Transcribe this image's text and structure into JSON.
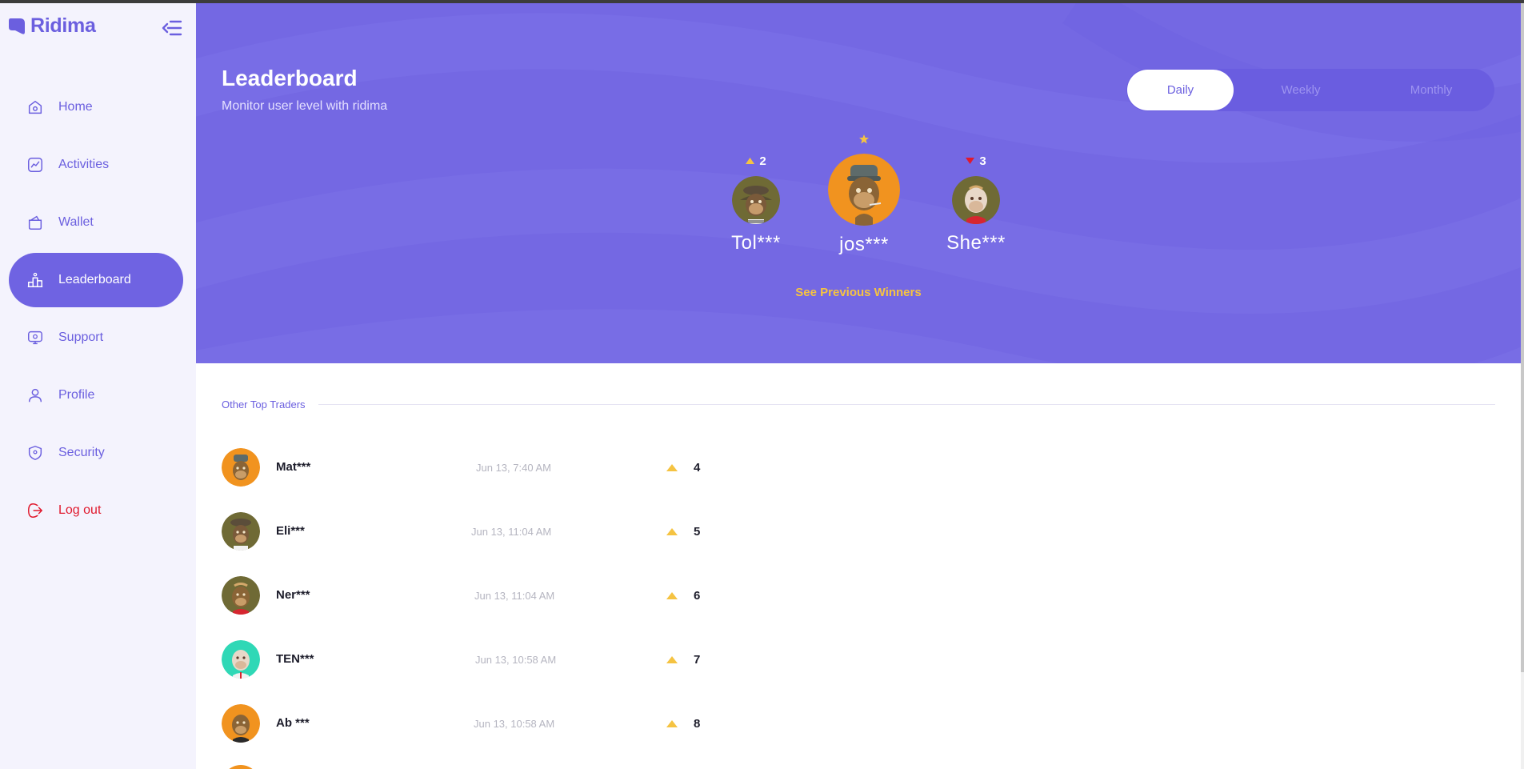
{
  "app": {
    "name": "Ridima"
  },
  "sidebar": {
    "items": [
      {
        "label": "Home",
        "icon": "home-icon"
      },
      {
        "label": "Activities",
        "icon": "chart-icon"
      },
      {
        "label": "Wallet",
        "icon": "wallet-icon"
      },
      {
        "label": "Leaderboard",
        "icon": "podium-icon",
        "active": true
      },
      {
        "label": "Support",
        "icon": "support-icon"
      },
      {
        "label": "Profile",
        "icon": "user-icon"
      },
      {
        "label": "Security",
        "icon": "shield-icon"
      },
      {
        "label": "Log out",
        "icon": "logout-icon"
      }
    ]
  },
  "header": {
    "title": "Leaderboard",
    "subtitle": "Monitor user level with ridima"
  },
  "periods": {
    "daily": "Daily",
    "weekly": "Weekly",
    "monthly": "Monthly",
    "selected": "Daily"
  },
  "podium": {
    "second": {
      "name": "Tol***",
      "rank": "2",
      "trend": "up"
    },
    "first": {
      "name": "jos***",
      "rank": "1"
    },
    "third": {
      "name": "She***",
      "rank": "3",
      "trend": "down"
    }
  },
  "see_previous": "See Previous Winners",
  "others": {
    "title": "Other Top Traders",
    "rows": [
      {
        "name": "Mat***",
        "time": "Jun 13, 7:40 AM",
        "rank": "4"
      },
      {
        "name": "Eli***",
        "time": "Jun 13, 11:04 AM",
        "rank": "5"
      },
      {
        "name": "Ner***",
        "time": "Jun 13, 11:04 AM",
        "rank": "6"
      },
      {
        "name": "TEN***",
        "time": "Jun 13, 10:58 AM",
        "rank": "7"
      },
      {
        "name": "Ab ***",
        "time": "Jun 13, 10:58 AM",
        "rank": "8"
      }
    ]
  },
  "colors": {
    "brand": "#6b5fdf",
    "hero": "#7468e3",
    "gold": "#f5c342",
    "logout": "#e0192d",
    "trend_up": "#f5c342",
    "trend_down": "#e0192d"
  }
}
